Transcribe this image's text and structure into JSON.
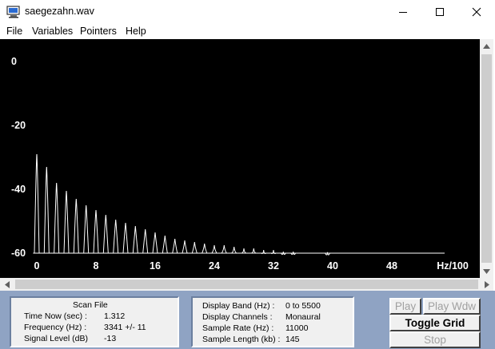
{
  "window": {
    "title": "saegezahn.wav"
  },
  "menu": [
    "File",
    "Variables",
    "Pointers",
    "Help"
  ],
  "chart_data": {
    "type": "bar",
    "y_ticks": [
      "0",
      "-20",
      "-40",
      "-60"
    ],
    "ylim": [
      -60,
      0
    ],
    "x_ticks": [
      "0",
      "8",
      "16",
      "24",
      "32",
      "40",
      "48"
    ],
    "xlabel": "Hz/100",
    "xlim": [
      -0.5,
      59
    ],
    "grid": false,
    "x": [
      0,
      1.33,
      2.67,
      4.0,
      5.33,
      6.67,
      8.0,
      9.33,
      10.67,
      12.0,
      13.33,
      14.67,
      16.0,
      17.33,
      18.67,
      20.0,
      21.33,
      22.67,
      24.0,
      25.33,
      26.67,
      28.0,
      29.33,
      30.67,
      32.0,
      33.33,
      34.67,
      39.3
    ],
    "values": [
      -29,
      -33,
      -38,
      -40.5,
      -43,
      -45,
      -46.5,
      -48,
      -49.5,
      -50.5,
      -51.5,
      -52.5,
      -53.5,
      -54.5,
      -55.5,
      -56,
      -56.5,
      -57,
      -57.5,
      -57.5,
      -58,
      -58.5,
      -58.5,
      -59,
      -59,
      -59.5,
      -59.5,
      -59.7
    ]
  },
  "scan_file": {
    "title": "Scan File",
    "rows": [
      {
        "label": "Time Now (sec) :",
        "value": "1.312"
      },
      {
        "label": "Frequency (Hz) :",
        "value": "3341 +/- 11"
      },
      {
        "label": "Signal Level (dB)",
        "value": "-13"
      }
    ]
  },
  "display_info": {
    "rows": [
      {
        "label": "Display Band (Hz) :",
        "value": "0 to 5500"
      },
      {
        "label": "Display Channels :",
        "value": "Monaural"
      },
      {
        "label": "Sample Rate (Hz) :",
        "value": "11000"
      },
      {
        "label": "Sample Length (kb) :",
        "value": "145"
      }
    ]
  },
  "buttons": {
    "play": "Play",
    "play_wdw": "Play Wdw",
    "toggle_grid": "Toggle Grid",
    "stop": "Stop"
  },
  "icons": [
    "app-icon",
    "minimize-icon",
    "maximize-icon",
    "close-icon",
    "scroll-up-icon",
    "scroll-down-icon",
    "scroll-left-icon",
    "scroll-right-icon"
  ]
}
